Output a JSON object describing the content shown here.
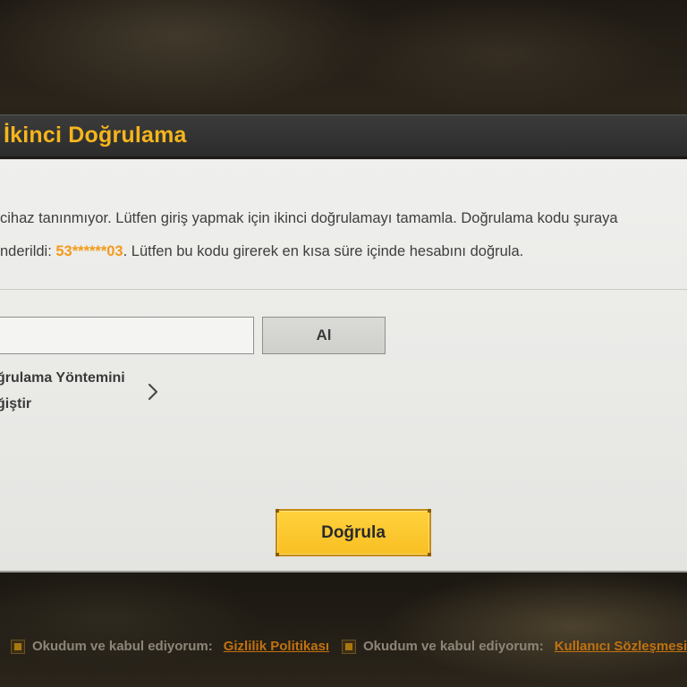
{
  "dialog": {
    "title": "İkinci Doğrulama",
    "message_line1": "cihaz tanınmıyor. Lütfen giriş yapmak için ikinci doğrulamayı tamamla. Doğrulama kodu şuraya",
    "message_line2_prefix": "nderildi: ",
    "masked_phone": "53******03",
    "message_line2_suffix": ". Lütfen bu kodu girerek en kısa süre içinde hesabını doğrula.",
    "code_input": {
      "value": "",
      "placeholder": ""
    },
    "get_button_label": "Al",
    "change_method_line1": "ğrulama Yöntemini",
    "change_method_line2": "ğiştir",
    "verify_button_label": "Doğrula"
  },
  "footer": {
    "agreements": [
      {
        "text": "Okudum ve kabul ediyorum:",
        "link": "Gizlilik Politikası"
      },
      {
        "text": "Okudum ve kabul ediyorum:",
        "link": "Kullanıcı Sözleşmesi"
      }
    ]
  },
  "colors": {
    "accent": "#f5b51c",
    "masked_phone": "#f39a1a",
    "button_yellow": "#f8bf22",
    "panel": "#ebebe8"
  },
  "icons": {
    "change_method": "chevron-right-icon",
    "agreement": "checkbox-icon"
  }
}
